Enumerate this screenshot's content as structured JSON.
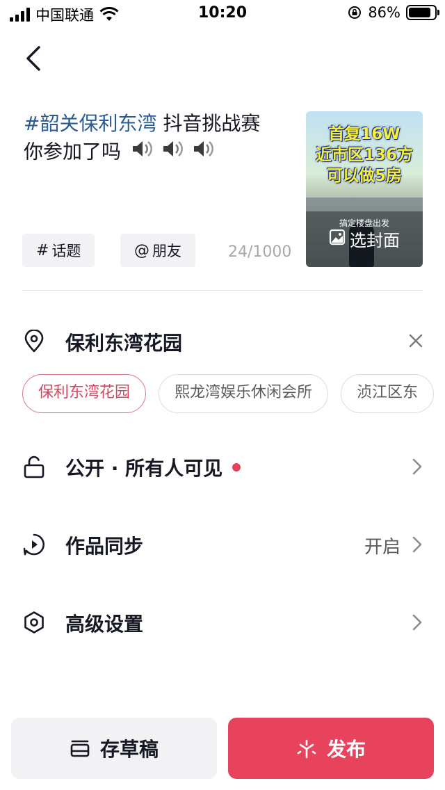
{
  "status_bar": {
    "carrier": "中国联通",
    "time": "10:20",
    "battery": "86%",
    "battery_level": 0.86
  },
  "caption": {
    "hashtag": "#韶关保利东湾",
    "text_line1": " 抖音挑战赛",
    "text_line2": "你参加了吗"
  },
  "cover": {
    "overlay_text": [
      "首复16W",
      "近市区136方",
      "可以做5房"
    ],
    "small_text": "搞定楼盘出发",
    "select_label": "选封面"
  },
  "chips": {
    "topic": "话题",
    "topic_symbol": "#",
    "friend": "朋友",
    "friend_symbol": "@"
  },
  "counter": "24/1000",
  "location": {
    "label": "保利东湾花园",
    "suggestions": [
      "保利东湾花园",
      "熙龙湾娱乐休闲会所",
      "浈江区东"
    ],
    "selected_index": 0
  },
  "privacy": {
    "label": "公开 · 所有人可见"
  },
  "sync": {
    "label": "作品同步",
    "value": "开启"
  },
  "advanced": {
    "label": "高级设置"
  },
  "actions": {
    "draft": "存草稿",
    "publish": "发布"
  },
  "colors": {
    "accent": "#e8435c",
    "hashtag": "#2a5c93",
    "chip_bg": "#f2f2f4"
  }
}
